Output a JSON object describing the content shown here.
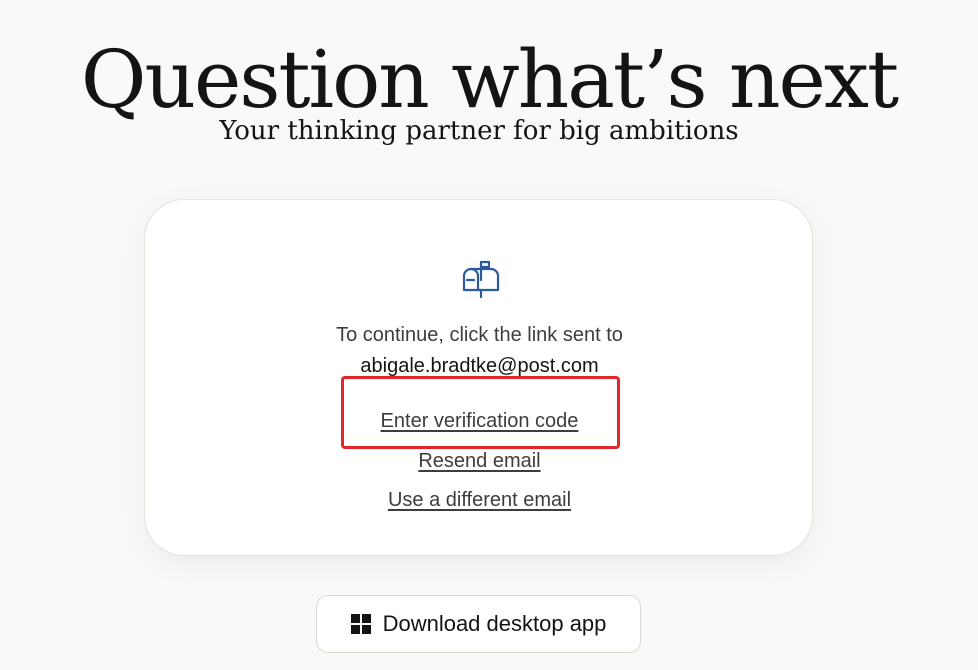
{
  "hero": {
    "title": "Question what’s next",
    "subtitle": "Your thinking partner for big ambitions"
  },
  "verification_card": {
    "icon": "mailbox-icon",
    "instruction": "To continue, click the link sent to",
    "email": "abigale.bradtke@post.com",
    "links": {
      "enter_code": "Enter verification code",
      "resend": "Resend email",
      "different_email": "Use a different email"
    }
  },
  "download": {
    "icon": "windows-icon",
    "label": "Download desktop app"
  },
  "colors": {
    "background": "#faf9f7",
    "card": "#ffffff",
    "icon_blue": "#2c5aa0",
    "highlight_red": "#e0282b",
    "text_dark": "#141413"
  }
}
